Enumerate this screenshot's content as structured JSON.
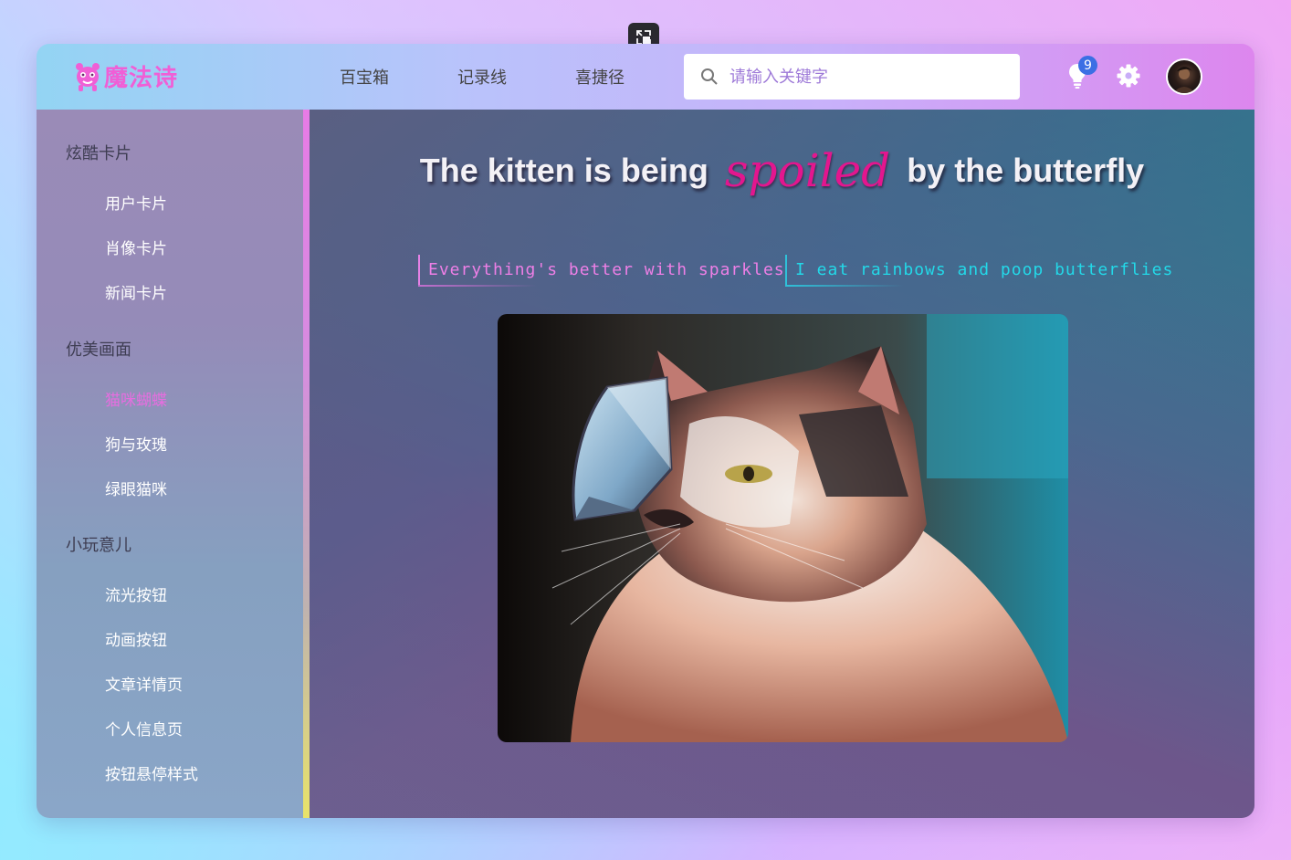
{
  "header": {
    "logo_text": "魔法诗",
    "nav": [
      "百宝箱",
      "记录线",
      "喜捷径"
    ],
    "search": {
      "placeholder": "请输入关键字",
      "value": ""
    },
    "notification_count": "9"
  },
  "sidebar": {
    "groups": [
      {
        "title": "炫酷卡片",
        "items": [
          "用户卡片",
          "肖像卡片",
          "新闻卡片"
        ]
      },
      {
        "title": "优美画面",
        "items": [
          "猫咪蝴蝶",
          "狗与玫瑰",
          "绿眼猫咪"
        ]
      },
      {
        "title": "小玩意儿",
        "items": [
          "流光按钮",
          "动画按钮",
          "文章详情页",
          "个人信息页",
          "按钮悬停样式"
        ]
      }
    ],
    "active_item": "猫咪蝴蝶"
  },
  "main": {
    "headline_before": "The kitten is being",
    "headline_accent": "spoiled",
    "headline_after": "by the butterfly",
    "tagline_1": "Everything's better with sparkles",
    "tagline_2": "I eat rainbows and poop butterflies"
  },
  "colors": {
    "accent_pink": "#f05fd6",
    "headline_accent": "#e3168e",
    "tagline_1": "#ee7fe6",
    "tagline_2": "#23d8e8",
    "badge": "#3b6fe4"
  },
  "icons": {
    "restore": "restore-window-icon",
    "logo": "monster-logo-icon",
    "search": "search-icon",
    "notifications": "lightbulb-icon",
    "settings": "gear-icon"
  }
}
